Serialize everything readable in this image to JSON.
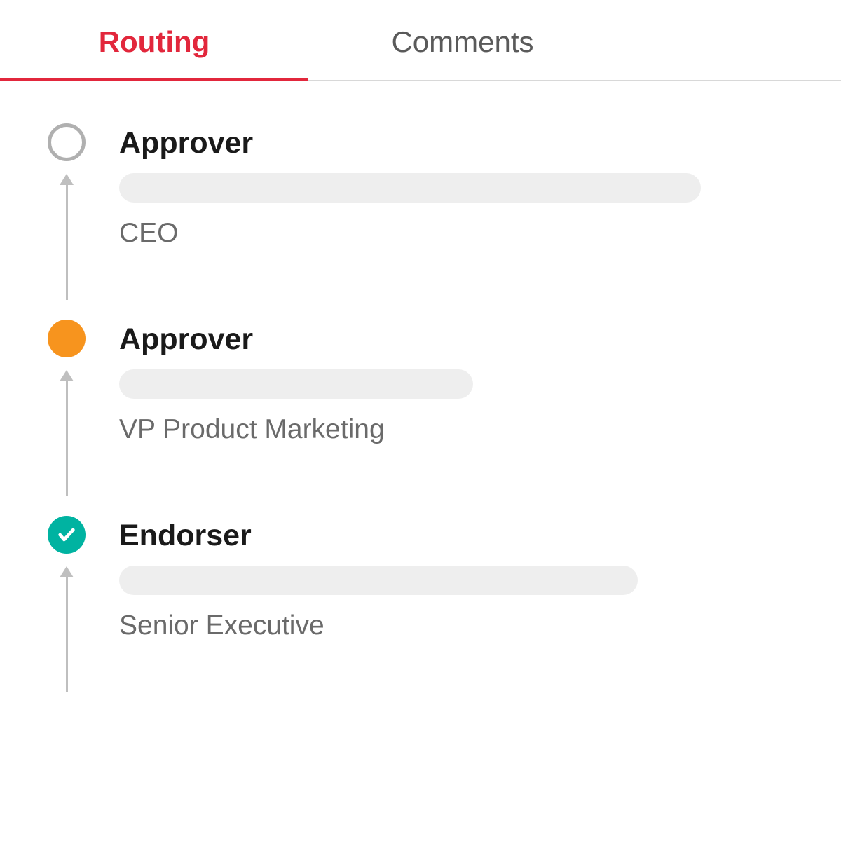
{
  "tabs": [
    {
      "label": "Routing",
      "active": true
    },
    {
      "label": "Comments",
      "active": false
    }
  ],
  "steps": [
    {
      "role": "Approver",
      "title": "CEO",
      "status": "empty"
    },
    {
      "role": "Approver",
      "title": "VP Product Marketing",
      "status": "pending"
    },
    {
      "role": "Endorser",
      "title": "Senior Executive",
      "status": "done"
    }
  ],
  "colors": {
    "active_tab": "#e2273c",
    "pending": "#f7941e",
    "done": "#00b3a1"
  }
}
